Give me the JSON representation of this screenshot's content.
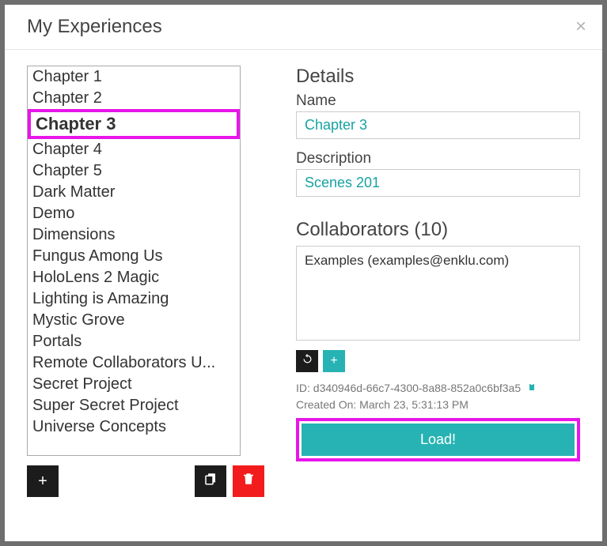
{
  "header": {
    "title": "My Experiences",
    "close_label": "×"
  },
  "experiences": {
    "selected": "Chapter 3",
    "items": [
      "Chapter 1",
      "Chapter 2",
      "Chapter 3",
      "Chapter 4",
      "Chapter 5",
      "Dark Matter",
      "Demo",
      "Dimensions",
      "Fungus Among Us",
      "HoloLens 2 Magic",
      "Lighting is Amazing",
      "Mystic Grove",
      "Portals",
      "Remote Collaborators U...",
      "Secret Project",
      "Super Secret Project",
      "Universe Concepts"
    ]
  },
  "left_actions": {
    "add": "+",
    "duplicate": "⎘",
    "delete": "🗑"
  },
  "details": {
    "heading": "Details",
    "name_label": "Name",
    "name_value": "Chapter 3",
    "desc_label": "Description",
    "desc_value": "Scenes 201"
  },
  "collaborators": {
    "heading": "Collaborators (10)",
    "entries": [
      "Examples (examples@enklu.com)"
    ],
    "refresh_icon": "↻",
    "add_icon": "+"
  },
  "meta": {
    "id_label": "ID:",
    "id_value": "d340946d-66c7-4300-8a88-852a0c6bf3a5",
    "created_label": "Created On:",
    "created_value": "March 23, 5:31:13 PM",
    "clipboard": "📋"
  },
  "load_label": "Load!"
}
